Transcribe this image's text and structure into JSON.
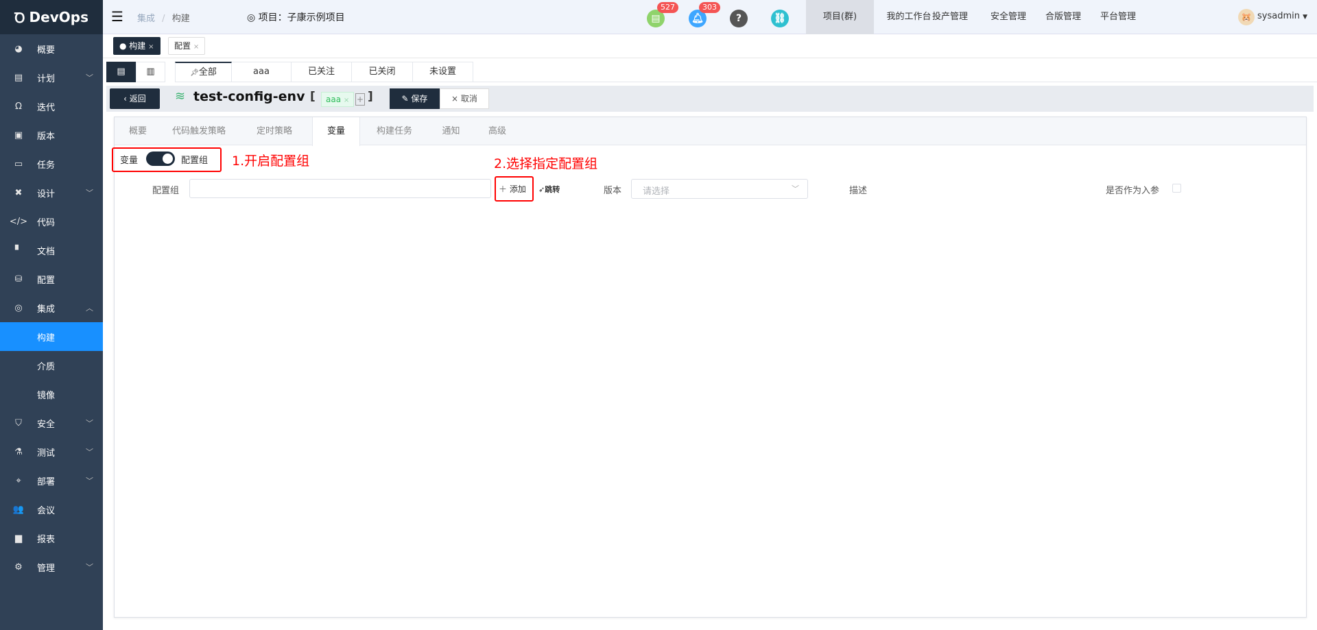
{
  "app": {
    "logo": "DevOps"
  },
  "sidebar": {
    "items": [
      {
        "label": "概要",
        "icon": "dashboard-icon",
        "sym": "◕"
      },
      {
        "label": "计划",
        "icon": "plan-icon",
        "sym": "▤",
        "chev": "﹀"
      },
      {
        "label": "迭代",
        "icon": "iteration-icon",
        "sym": "Ω"
      },
      {
        "label": "版本",
        "icon": "version-icon",
        "sym": "▣"
      },
      {
        "label": "任务",
        "icon": "task-icon",
        "sym": "▭"
      },
      {
        "label": "设计",
        "icon": "design-icon",
        "sym": "✖",
        "chev": "﹀"
      },
      {
        "label": "代码",
        "icon": "code-icon",
        "sym": "</>"
      },
      {
        "label": "文档",
        "icon": "document-icon",
        "sym": "▘"
      },
      {
        "label": "配置",
        "icon": "config-icon",
        "sym": "⛁"
      },
      {
        "label": "集成",
        "icon": "integration-icon",
        "sym": "◎",
        "chev": "︿"
      },
      {
        "label": "构建",
        "sub": true,
        "active": true
      },
      {
        "label": "介质",
        "sub": true
      },
      {
        "label": "镜像",
        "sub": true
      },
      {
        "label": "安全",
        "icon": "shield-icon",
        "sym": "⛉",
        "chev": "﹀"
      },
      {
        "label": "测试",
        "icon": "flask-icon",
        "sym": "⚗",
        "chev": "﹀"
      },
      {
        "label": "部署",
        "icon": "crosshair-icon",
        "sym": "⌖",
        "chev": "﹀"
      },
      {
        "label": "会议",
        "icon": "meeting-icon",
        "sym": "👥"
      },
      {
        "label": "报表",
        "icon": "report-icon",
        "sym": "▆"
      },
      {
        "label": "管理",
        "icon": "gear-icon",
        "sym": "⚙",
        "chev": "﹀"
      }
    ]
  },
  "header": {
    "breadcrumb": [
      "集成",
      "构建"
    ],
    "sep": "/",
    "project": "项目：子康示例项目",
    "badges": {
      "docs": "527",
      "bell": "303"
    },
    "nav": [
      "项目(群)",
      "我的工作台",
      "投产管理",
      "安全管理",
      "合版管理",
      "平台管理"
    ],
    "user": "sysadmin"
  },
  "tags": [
    {
      "label": "构建",
      "close": "×"
    },
    {
      "label": "配置",
      "close": "×"
    }
  ],
  "filters": [
    "全部",
    "aaa",
    "已关注",
    "已关闭",
    "未设置"
  ],
  "titlebar": {
    "back": "返回",
    "title": "test-config-env",
    "tag": "aaa",
    "tag_close": "×",
    "add": "+",
    "save": "保存",
    "cancel": "取消",
    "lb": "[",
    "rb": "]"
  },
  "tabs": [
    "概要",
    "代码触发策略",
    "定时策略",
    "变量",
    "构建任务",
    "通知",
    "高级"
  ],
  "form": {
    "toggle_left": "变量",
    "toggle_right": "配置组",
    "group_label": "配置组",
    "group_value": "",
    "add": "添加",
    "jump": "跳转",
    "version_label": "版本",
    "version_placeholder": "请选择",
    "desc_label": "描述",
    "param_label": "是否作为入参"
  },
  "annotations": {
    "step1": "1.开启配置组",
    "step2": "2.选择指定配置组"
  },
  "colors": {
    "accent": "#1890ff",
    "dark": "#1f2d3d",
    "annotation": "#ff0000"
  }
}
